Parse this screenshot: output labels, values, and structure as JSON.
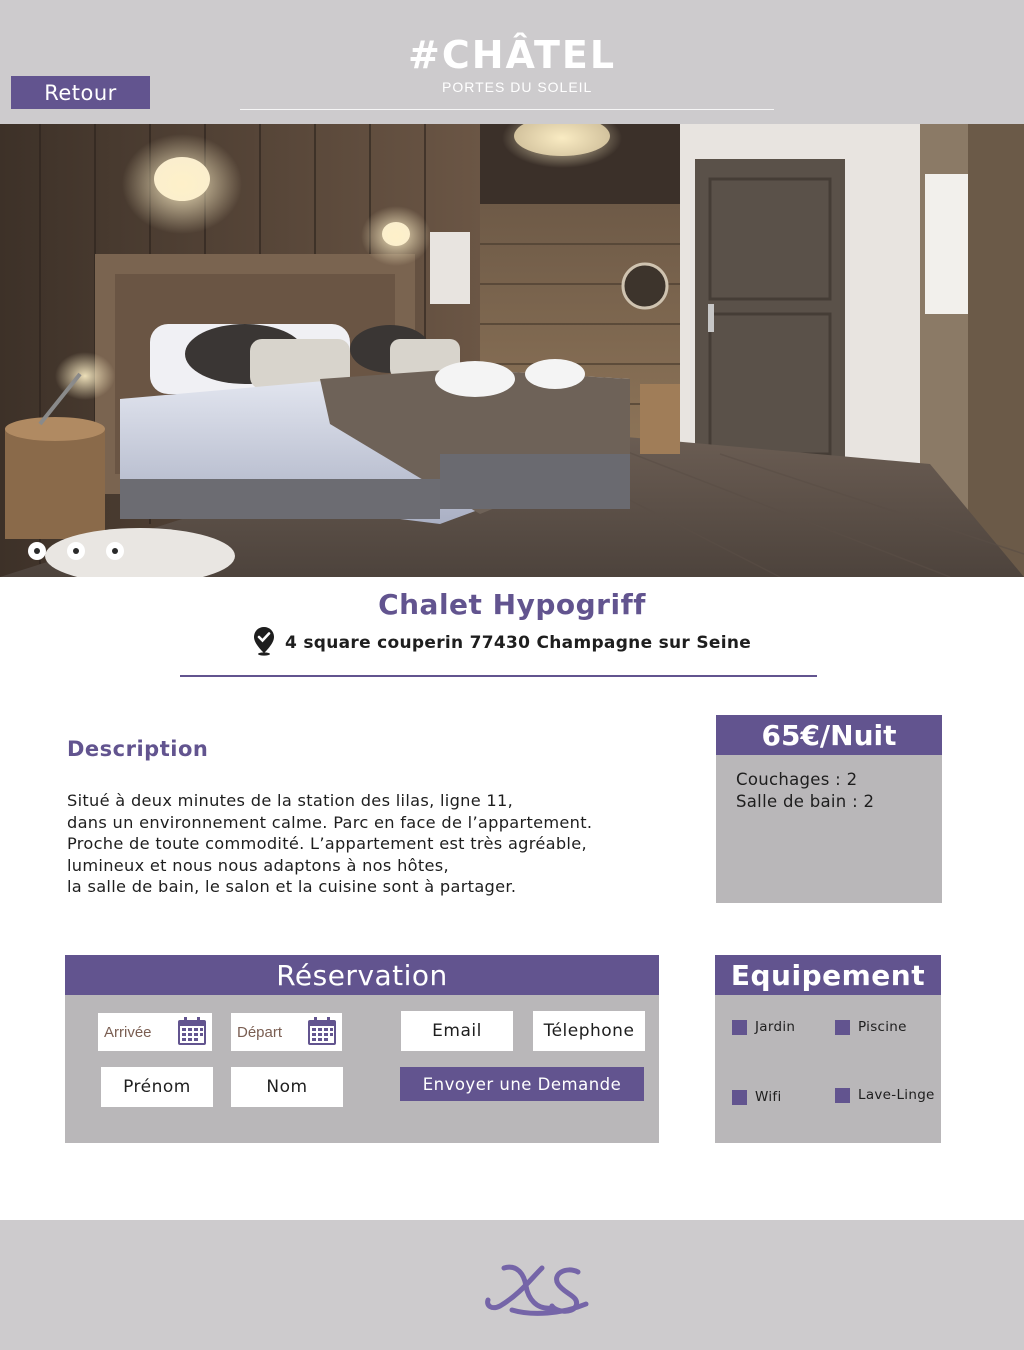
{
  "header": {
    "back_label": "Retour",
    "logo_main": "#CHÂTEL",
    "logo_sub": "PORTES DU SOLEIL"
  },
  "carousel": {
    "slide_count": 3,
    "icon": "carousel-dot"
  },
  "listing": {
    "title": "Chalet Hypogriff",
    "address": "4 square couperin 77430 Champagne sur Seine",
    "address_icon": "location-pin-check-icon"
  },
  "description": {
    "heading": "Description",
    "lines": [
      "Situé à deux minutes de la station des lilas, ligne 11,",
      "dans un environnement calme. Parc en face de l’appartement.",
      "Proche de toute commodité. L’appartement est très agréable,",
      "lumineux et nous nous adaptons à nos hôtes,",
      "la salle de bain, le salon et la cuisine sont à partager."
    ]
  },
  "pricing": {
    "price": "65€/Nuit",
    "info": [
      "Couchages : 2",
      "Salle de bain : 2"
    ]
  },
  "reservation": {
    "heading": "Réservation",
    "arrival_label": "Arrivée",
    "departure_label": "Départ",
    "email_label": "Email",
    "phone_label": "Télephone",
    "firstname_label": "Prénom",
    "lastname_label": "Nom",
    "submit_label": "Envoyer une Demande",
    "calendar_icon": "calendar-icon"
  },
  "equipment": {
    "heading": "Equipement",
    "items": [
      "Jardin",
      "Piscine",
      "Wifi",
      "Lave-Linge"
    ]
  },
  "footer": {
    "logo_icon": "xs-monogram-logo"
  },
  "colors": {
    "accent": "#62548f",
    "panel": "#b9b7b9",
    "header_bg": "#cdcbcd",
    "white": "#ffffff"
  }
}
